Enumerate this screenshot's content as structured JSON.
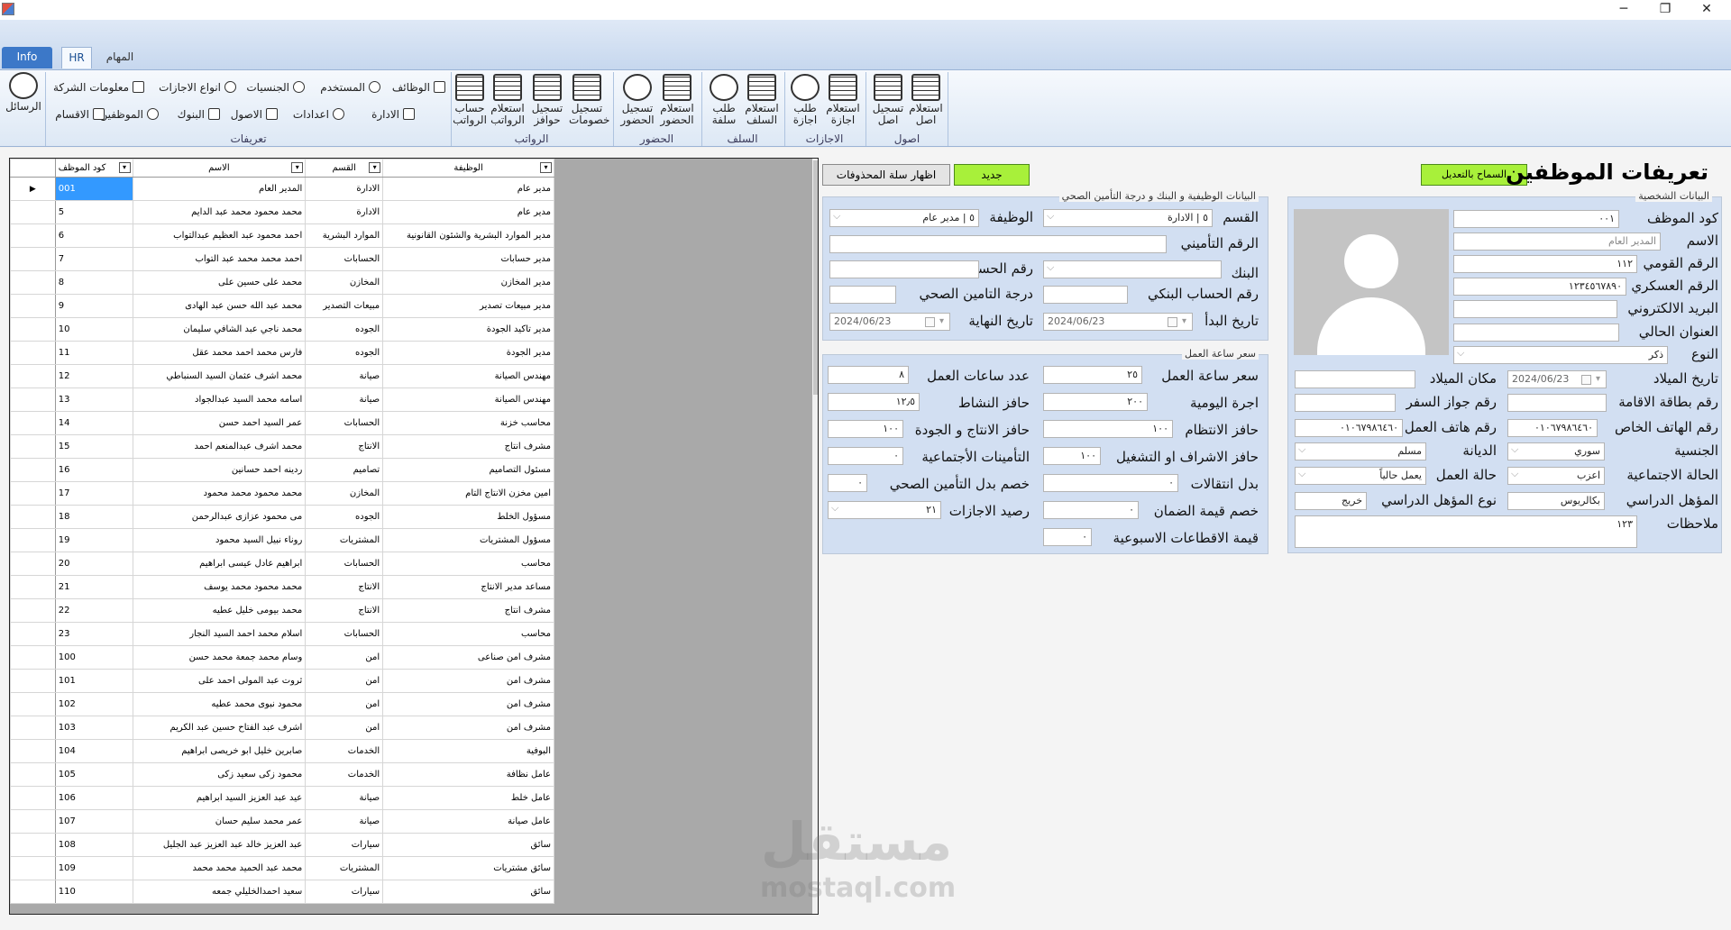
{
  "window": {
    "minimize": "─",
    "maximize": "❐",
    "close": "✕"
  },
  "tabs": {
    "info": "Info",
    "hr": "HR",
    "tasks": "المهام"
  },
  "ribbon": {
    "messages": "الرسائل",
    "definitions": {
      "label": "تعريفات",
      "items": [
        "الوظائف",
        "المستخدم",
        "الجنسيات",
        "انواع الاجازات",
        "معلومات الشركة",
        "الادارة",
        "اعدادات",
        "الاصول",
        "البنوك",
        "الموظفين",
        "الاقسام"
      ]
    },
    "salaries": {
      "label": "الرواتب",
      "items": [
        "تسجيل خصومات",
        "تسجيل حوافز",
        "استعلام الرواتب",
        "حساب الرواتب"
      ]
    },
    "attendance": {
      "label": "الحضور",
      "items": [
        "استعلام الحضور",
        "تسجيل الحضور"
      ]
    },
    "loans": {
      "label": "السلف",
      "items": [
        "استعلام السلف",
        "طلب سلفة"
      ]
    },
    "leaves": {
      "label": "الاجازات",
      "items": [
        "استعلام اجازة",
        "طلب اجازة"
      ]
    },
    "assets": {
      "label": "اصول",
      "items": [
        "استعلام اصل",
        "تسجيل اصل"
      ]
    }
  },
  "grid": {
    "headers": [
      "كود الموظف",
      "الاسم",
      "القسم",
      "الوظيفة"
    ],
    "rows": [
      [
        "001",
        "المدير العام",
        "الادارة",
        "مدير عام"
      ],
      [
        "5",
        "محمد محمود محمد عبد الدايم",
        "الادارة",
        "مدير عام"
      ],
      [
        "6",
        "احمد محمود عبد العظيم عبدالتواب",
        "الموارد البشرية",
        "مدير الموارد البشرية والشئون القانونية"
      ],
      [
        "7",
        "احمد محمد محمد عبد التواب",
        "الحسابات",
        "مدير حسابات"
      ],
      [
        "8",
        "محمد على حسين على",
        "المخازن",
        "مدير المخازن"
      ],
      [
        "9",
        "محمد عبد الله حسن عبد الهادى",
        "مبيعات التصدير",
        "مدير مبيعات تصدير"
      ],
      [
        "10",
        "محمد ناجي عبد الشافي سليمان",
        "الجوده",
        "مدير تاكيد الجودة"
      ],
      [
        "11",
        "فارس محمد احمد محمد عقل",
        "الجوده",
        "مدير الجودة"
      ],
      [
        "12",
        "محمد اشرف عثمان السيد السنباطي",
        "صيانة",
        "مهندس الصيانة"
      ],
      [
        "13",
        "اسامه محمد السيد عبدالجواد",
        "صيانة",
        "مهندس الصيانة"
      ],
      [
        "14",
        "عمر السيد احمد حسن",
        "الحسابات",
        "محاسب خزنة"
      ],
      [
        "15",
        "محمد اشرف عبدالمنعم احمد",
        "الانتاج",
        "مشرف انتاج"
      ],
      [
        "16",
        "ردينه احمد حسانين",
        "تصاميم",
        "مسئول التصاميم"
      ],
      [
        "17",
        "محمد محمود محمد محمود",
        "المخازن",
        "امين مخزن الانتاج التام"
      ],
      [
        "18",
        "مى محمود عزازى عبدالرحمن",
        "الجوده",
        "مسؤول الخلط"
      ],
      [
        "19",
        "روناء نبيل السيد محمود",
        "المشتريات",
        "مسؤول المشتريات"
      ],
      [
        "20",
        "ابراهيم عادل عيسى ابراهيم",
        "الحسابات",
        "محاسب"
      ],
      [
        "21",
        "محمد محمود محمد يوسف",
        "الانتاج",
        "مساعد مدير الانتاج"
      ],
      [
        "22",
        "محمد بيومى خليل عطيه",
        "الانتاج",
        "مشرف انتاج"
      ],
      [
        "23",
        "اسلام محمد احمد السيد النجار",
        "الحسابات",
        "محاسب"
      ],
      [
        "100",
        "وسام محمد جمعة محمد حسن",
        "امن",
        "مشرف امن صناعى"
      ],
      [
        "101",
        "ثروت عبد المولى احمد على",
        "امن",
        "مشرف امن"
      ],
      [
        "102",
        "محمود نبوى محمد عطيه",
        "امن",
        "مشرف امن"
      ],
      [
        "103",
        "اشرف عبد الفتاح حسين عبد الكريم",
        "امن",
        "مشرف امن"
      ],
      [
        "104",
        "صابرين خليل ابو خريصى ابراهيم",
        "الخدمات",
        "البوفية"
      ],
      [
        "105",
        "محمود زكى سعيد زكى",
        "الخدمات",
        "عامل نظافة"
      ],
      [
        "106",
        "عيد عبد العزيز السيد ابراهيم",
        "صيانة",
        "عامل خلط"
      ],
      [
        "107",
        "عمر محمد سليم حسان",
        "صيانة",
        "عامل صيانة"
      ],
      [
        "108",
        "عبد العزيز خالد عبد العزيز عبد الجليل",
        "سيارات",
        "سائق"
      ],
      [
        "109",
        "محمد عبد الحميد محمد محمد",
        "المشتريات",
        "سائق مشتريات"
      ],
      [
        "110",
        "سعيد احمدالخليلي جمعه",
        "سيارات",
        "سائق"
      ]
    ]
  },
  "buttons": {
    "show_deleted": "اظهار سلة المحذوفات",
    "new": "جديد",
    "allow_edit": "السماح بالتعديل"
  },
  "page_title": "تعريفات الموظفين",
  "personal": {
    "title": "البيانات الشخصية",
    "labels": {
      "code": "كود الموظف",
      "name": "الاسم",
      "national_id": "الرقم القومي",
      "military_no": "الرقم العسكري",
      "email": "البريد الالكتروني",
      "address": "العنوان الحالي",
      "gender": "النوع",
      "birth_date": "تاريخ الميلاد",
      "birth_place": "مكان الميلاد",
      "residence_card": "رقم بطاقة الاقامة",
      "passport": "رقم جواز السفر",
      "private_phone": "رقم الهاتف الخاص",
      "work_phone": "رقم هاتف العمل",
      "nationality": "الجنسية",
      "religion": "الديانة",
      "marital": "الحالة الاجتماعية",
      "work_status": "حالة العمل",
      "qualification": "المؤهل الدراسي",
      "qualification_type": "نوع المؤهل الدراسي",
      "notes": "ملاحظات"
    },
    "values": {
      "code": "٠٠١",
      "name": "المدير العام",
      "national_id": "١١٢",
      "military_no": "١٢٣٤٥٦٧٨٩٠",
      "email": "",
      "address": "",
      "gender": "ذكر",
      "birth_date": "2024/06/23",
      "birth_place": "",
      "residence_card": "",
      "passport": "",
      "private_phone": "٠١٠٦٧٩٨٦٤٦٠",
      "work_phone": "٠١٠٦٧٩٨٦٤٦٠",
      "nationality": "سوري",
      "religion": "مسلم",
      "marital": "اعزب",
      "work_status": "يعمل حالياً",
      "qualification": "بكالريوس",
      "qualification_type": "خريج",
      "notes": "١٢٣"
    }
  },
  "job": {
    "title": "البيانات الوظيفية و البنك و درجة التأمين الصحي",
    "labels": {
      "department": "القسم",
      "job": "الوظيفة",
      "insurance_no": "الرقم التأميني",
      "bank": "البنك",
      "account_no": "رقم الحساب",
      "bank_account": "رقم الحساب البنكي",
      "health_grade": "درجة التامين الصحي",
      "start_date": "تاريخ البدأ",
      "end_date": "تاريخ النهاية"
    },
    "values": {
      "department": "٥ | الادارة",
      "job": "٥ | مدير عام",
      "insurance_no": "",
      "bank": "",
      "account_no": "",
      "bank_account": "",
      "health_grade": "",
      "start_date": "2024/06/23",
      "end_date": "2024/06/23"
    }
  },
  "hour": {
    "title": "سعر ساعة العمل",
    "labels": {
      "hour_price": "سعر ساعة العمل",
      "work_hours": "عدد ساعات العمل",
      "daily_wage": "اجرة اليومية",
      "activity_bonus": "حافز النشاط",
      "discipline_bonus": "حافز الانتظام",
      "production_bonus": "حافز الانتاج و الجودة",
      "supervision_bonus": "حافز الاشراف او التشغيل",
      "social_insurance": "التأمينات الأجتماعية",
      "transport": "بدل انتقالات",
      "health_deduction": "خصم بدل التأمين الصحي",
      "guarantee_deduction": "خصم قيمة الضمان",
      "leave_balance": "رصيد الاجازات",
      "weekly_deductions": "قيمة الاقطاعات الاسبوعية"
    },
    "values": {
      "hour_price": "٢٥",
      "work_hours": "٨",
      "daily_wage": "٢٠٠",
      "activity_bonus": "١٢٫٥",
      "discipline_bonus": "١٠٠",
      "production_bonus": "١٠٠",
      "supervision_bonus": "١٠٠",
      "social_insurance": "٠",
      "transport": "٠",
      "health_deduction": "٠",
      "guarantee_deduction": "٠",
      "leave_balance": "٢١",
      "weekly_deductions": "٠"
    }
  },
  "watermark": {
    "arabic": "مستقل",
    "latin": "mostaql.com"
  }
}
